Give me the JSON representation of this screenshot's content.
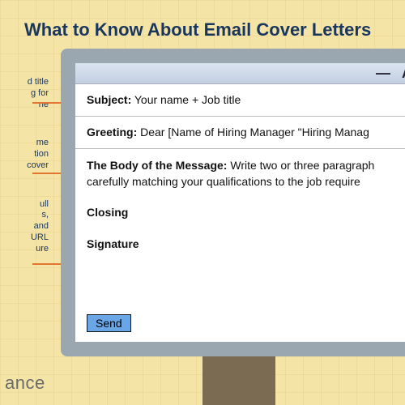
{
  "title": "What to Know About Email Cover Letters",
  "callouts": [
    "d title\ng for\nne",
    "me\ntion\ncover",
    "ull\ns,\nand\nURL\nure"
  ],
  "window": {
    "minimize": "—",
    "expand_hint": "A"
  },
  "email": {
    "subject_label": "Subject:",
    "subject_value": "Your name + Job title",
    "greeting_label": "Greeting:",
    "greeting_value": "Dear [Name of Hiring Manager \"Hiring Manag",
    "body_label": "The Body of the Message:",
    "body_value": "Write two or three paragraph carefully matching your qualifications to the job require",
    "closing": "Closing",
    "signature": "Signature",
    "send": "Send"
  },
  "brand": "ance"
}
